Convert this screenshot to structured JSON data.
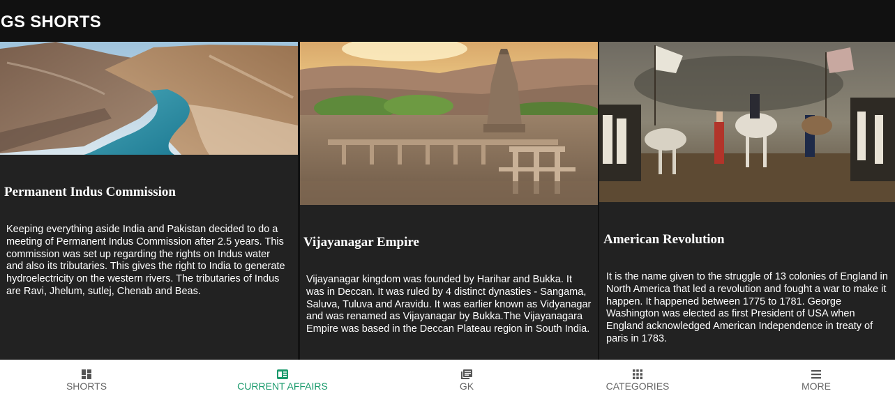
{
  "app": {
    "title": "GS SHORTS"
  },
  "cards": [
    {
      "title": "Permanent Indus Commission",
      "description": "Keeping everything aside India and Pakistan decided to do a meeting of Permanent Indus Commission after 2.5 years. This commission was set up regarding the rights on Indus water and also its tributaries. This gives the right to India to generate hydroelectricity on the western rivers. The tributaries of Indus are Ravi, Jhelum, sutlej, Chenab and Beas."
    },
    {
      "title": "Vijayanagar Empire",
      "description": "Vijayanagar kingdom was founded by Harihar and Bukka. It was in Deccan. It was ruled by 4 distinct dynasties - Sangama, Saluva, Tuluva and Aravidu. It was earlier known as Vidyanagar and was renamed as Vijayanagar by Bukka.The Vijayanagara Empire was based in the Deccan Plateau region in South India."
    },
    {
      "title": "American Revolution",
      "description": "It is the name given to the struggle of 13 colonies of England in North America that led a revolution and fought a war to make it happen. It happened between 1775 to 1781. George Washington was elected as first President of USA when England acknowledged American Independence in treaty of paris in 1783."
    }
  ],
  "nav": {
    "items": [
      {
        "label": "SHORTS",
        "icon": "dashboard-icon"
      },
      {
        "label": "CURRENT AFFAIRS",
        "icon": "newspaper-icon",
        "active": true
      },
      {
        "label": "GK",
        "icon": "library-books-icon"
      },
      {
        "label": "CATEGORIES",
        "icon": "apps-grid-icon"
      },
      {
        "label": "MORE",
        "icon": "menu-icon"
      }
    ],
    "active_color": "#1a9a6c",
    "inactive_color": "#666666"
  }
}
